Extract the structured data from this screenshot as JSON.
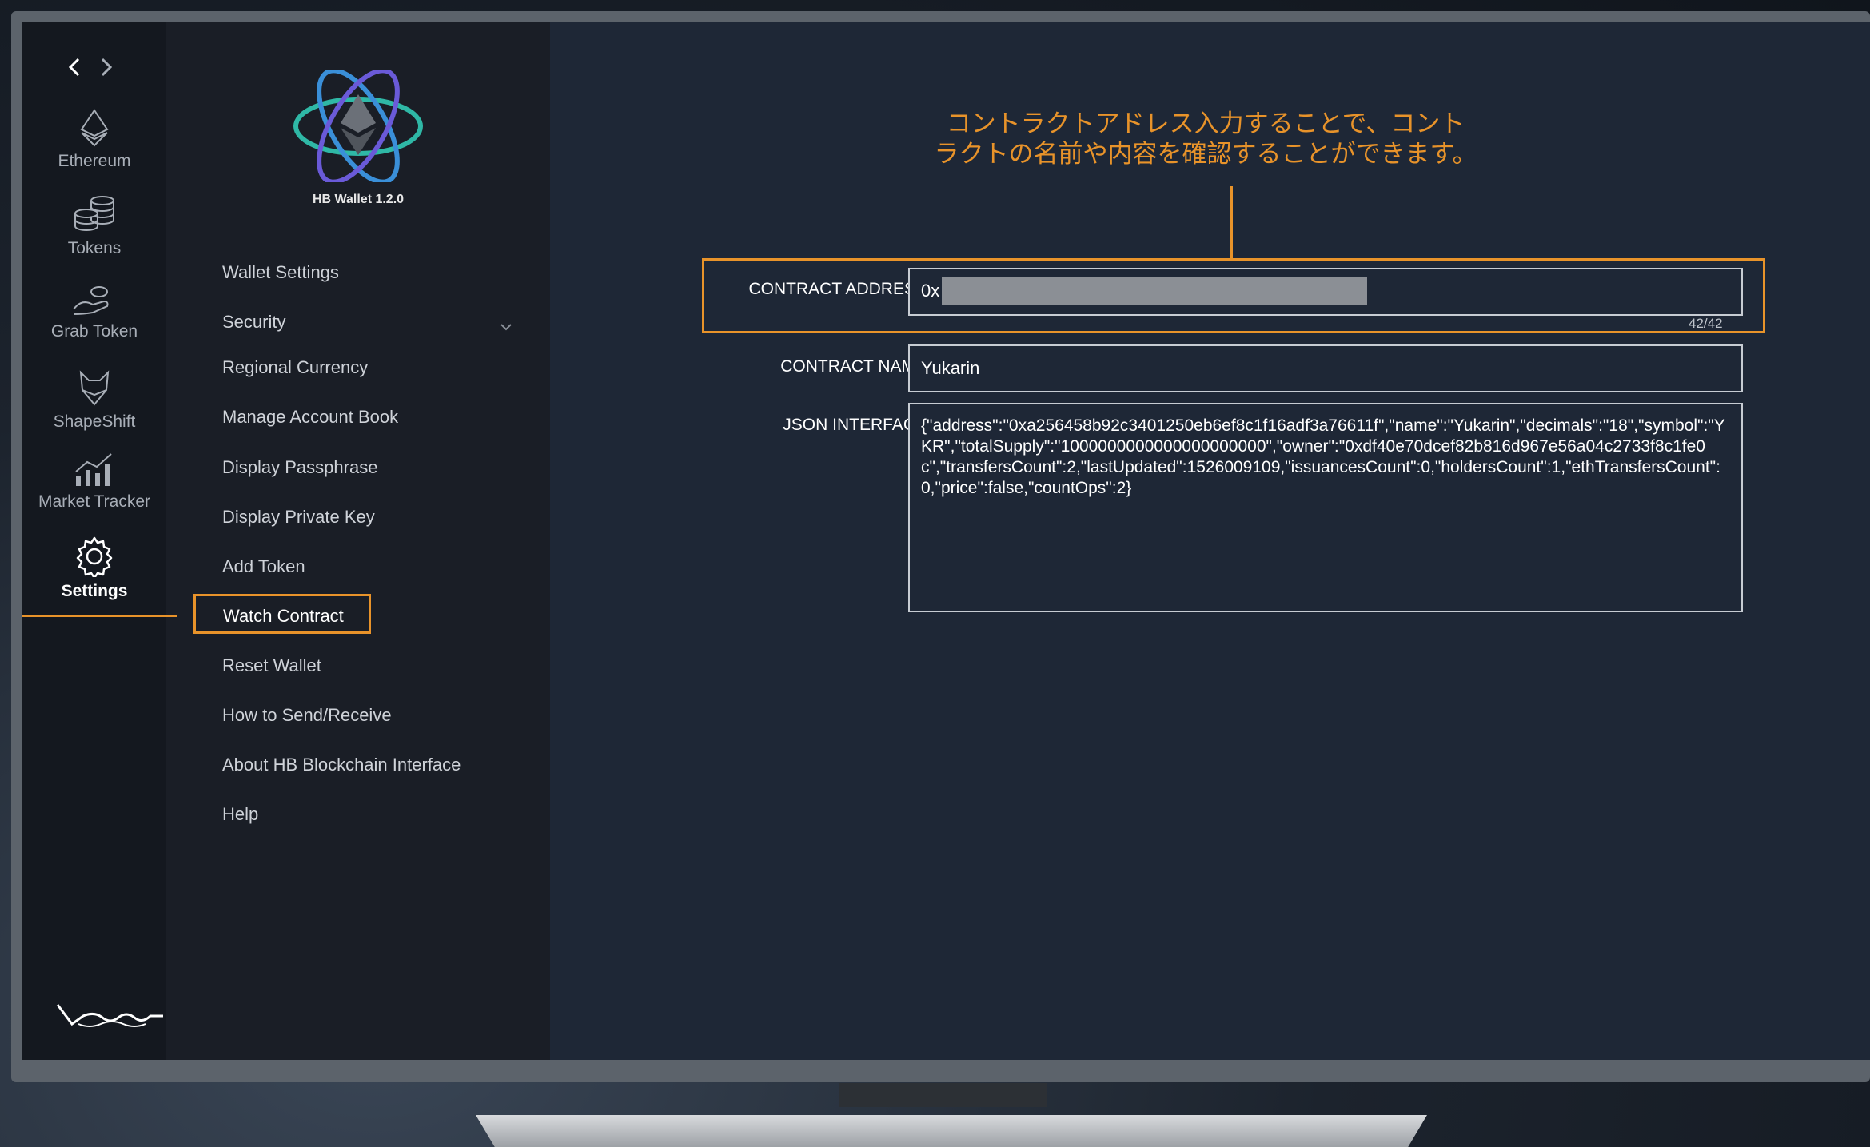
{
  "window": {
    "nav_back_icon": "chevron-left-icon",
    "nav_forward_icon": "chevron-right-icon"
  },
  "rail": {
    "items": [
      {
        "label": "Ethereum",
        "icon": "ethereum-icon"
      },
      {
        "label": "Tokens",
        "icon": "coins-icon"
      },
      {
        "label": "Grab Token",
        "icon": "hand-coin-icon"
      },
      {
        "label": "ShapeShift",
        "icon": "fox-icon"
      },
      {
        "label": "Market Tracker",
        "icon": "chart-icon"
      },
      {
        "label": "Settings",
        "icon": "gear-icon",
        "active": true
      }
    ]
  },
  "brand": {
    "version": "HB Wallet 1.2.0",
    "logo_icon": "atom-ethereum-logo"
  },
  "menu": {
    "items": [
      {
        "label": "Wallet Settings"
      },
      {
        "label": "Security",
        "expandable": true
      },
      {
        "label": "Regional Currency"
      },
      {
        "label": "Manage Account Book"
      },
      {
        "label": "Display Passphrase"
      },
      {
        "label": "Display Private Key"
      },
      {
        "label": "Add Token"
      },
      {
        "label": "Watch Contract",
        "selected": true
      },
      {
        "label": "Reset Wallet"
      },
      {
        "label": "How to Send/Receive"
      },
      {
        "label": "About HB Blockchain Interface"
      },
      {
        "label": "Help"
      }
    ]
  },
  "callout": {
    "line1": "コントラクトアドレス入力することで、コント",
    "line2": "ラクトの名前や内容を確認することができます。"
  },
  "form": {
    "address_label": "CONTRACT ADDRESS",
    "address_value": "0x",
    "address_counter": "42/42",
    "name_label": "CONTRACT NAME",
    "name_value": "Yukarin",
    "json_label": "JSON INTERFACE",
    "json_value": "{\"address\":\"0xa256458b92c3401250eb6ef8c1f16adf3a76611f\",\"name\":\"Yukarin\",\"decimals\":\"18\",\"symbol\":\"YKR\",\"totalSupply\":\"1000000000000000000000\",\"owner\":\"0xdf40e70dcef82b816d967e56a04c2733f8c1fe0c\",\"transfersCount\":2,\"lastUpdated\":1526009109,\"issuancesCount\":0,\"holdersCount\":1,\"ethTransfersCount\":0,\"price\":false,\"countOps\":2}"
  },
  "colors": {
    "accent": "#e8932a",
    "screen_bg": "#1e2736",
    "rail_bg": "#14181f",
    "menu_bg": "#1a1e26"
  }
}
